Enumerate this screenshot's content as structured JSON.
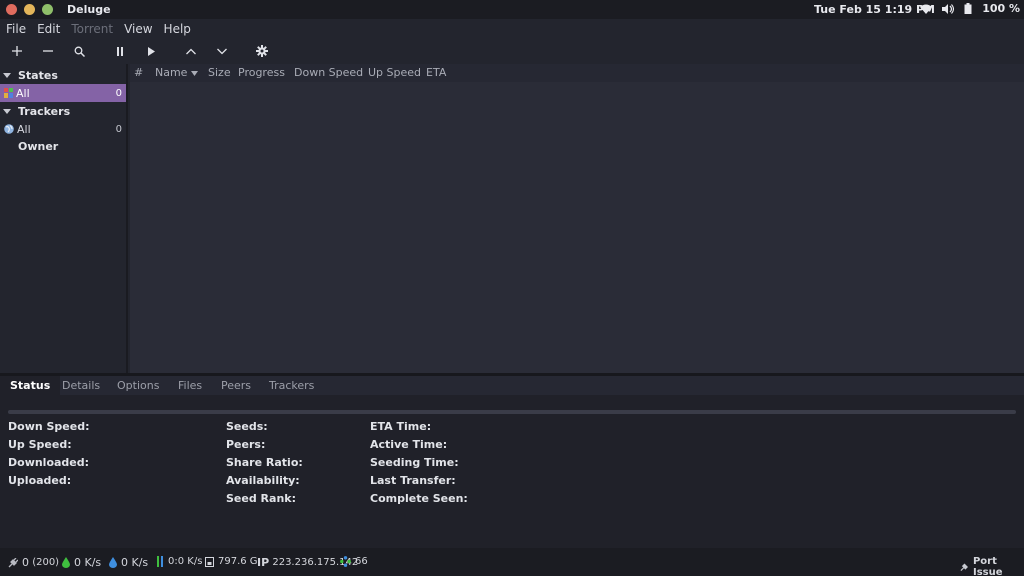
{
  "window": {
    "title": "Deluge",
    "clock": "Tue Feb 15   1:19 PM",
    "battery": "100 %"
  },
  "menu": {
    "file": "File",
    "edit": "Edit",
    "torrent": "Torrent",
    "view": "View",
    "help": "Help"
  },
  "toolbar": {
    "icons": [
      "plus-icon",
      "minus-icon",
      "search-icon",
      "pause-icon",
      "play-icon",
      "chevron-up-icon",
      "chevron-down-icon",
      "gear-icon"
    ]
  },
  "sidebar": {
    "states_label": "States",
    "states_all_label": "All",
    "states_all_count": "0",
    "trackers_label": "Trackers",
    "trackers_all_label": "All",
    "trackers_all_count": "0",
    "owner_label": "Owner"
  },
  "torrent_list": {
    "columns": [
      "#",
      "Name",
      "Size",
      "Progress",
      "Down Speed",
      "Up Speed",
      "ETA"
    ]
  },
  "tabs": [
    "Status",
    "Details",
    "Options",
    "Files",
    "Peers",
    "Trackers"
  ],
  "status_panel": {
    "col1": [
      "Down Speed:",
      "Up Speed:",
      "Downloaded:",
      "Uploaded:"
    ],
    "col2": [
      "Seeds:",
      "Peers:",
      "Share Ratio:",
      "Availability:",
      "Seed Rank:"
    ],
    "col3": [
      "ETA Time:",
      "Active Time:",
      "Seeding Time:",
      "Last Transfer:",
      "Complete Seen:"
    ]
  },
  "statusbar": {
    "connections": "0",
    "connections_max": "(200)",
    "down_speed": "0 K/s",
    "up_speed": "0 K/s",
    "protocol": "0:0 K/s",
    "free_space": "797.6 G",
    "ip_label": "IP",
    "ip_value": "223.236.175.142",
    "dht_nodes": "66",
    "port_issue": "Port Issue"
  },
  "colors": {
    "selection": "#8463a6",
    "down_icon": "#3fbf3f",
    "up_icon": "#3f8fdf"
  }
}
